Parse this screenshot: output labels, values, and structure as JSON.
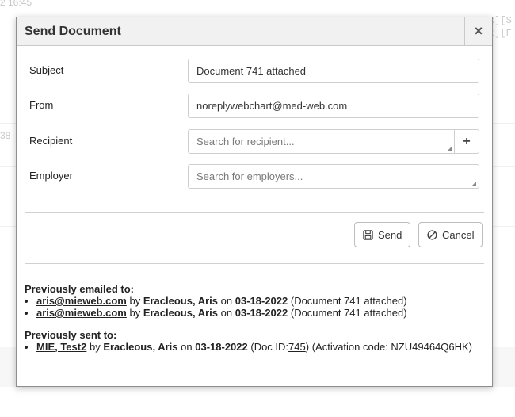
{
  "background": {
    "time_fragment": "2 16:45",
    "number_fragment": "38",
    "links_fragment_top": "x][S",
    "links_fragment_bottom": "t][F"
  },
  "dialog": {
    "title": "Send Document",
    "close_symbol": "×",
    "fields": {
      "subject": {
        "label": "Subject",
        "value": "Document 741 attached"
      },
      "from": {
        "label": "From",
        "value": "noreplywebchart@med-web.com"
      },
      "recipient": {
        "label": "Recipient",
        "placeholder": "Search for recipient...",
        "add_symbol": "+"
      },
      "employer": {
        "label": "Employer",
        "placeholder": "Search for employers..."
      }
    },
    "buttons": {
      "send": "Send",
      "cancel": "Cancel"
    },
    "previously_emailed": {
      "title": "Previously emailed to:",
      "entries": [
        {
          "email": "aris@mieweb.com",
          "by_text": "by",
          "sender": "Eracleous, Aris",
          "on_text": "on",
          "date": "03-18-2022",
          "note": "(Document 741 attached)"
        },
        {
          "email": "aris@mieweb.com",
          "by_text": "by",
          "sender": "Eracleous, Aris",
          "on_text": "on",
          "date": "03-18-2022",
          "note": "(Document 741 attached)"
        }
      ]
    },
    "previously_sent": {
      "title": "Previously sent to:",
      "entries": [
        {
          "recipient": "MIE, Test2",
          "by_text": "by",
          "sender": "Eracleous, Aris",
          "on_text": "on",
          "date": "03-18-2022",
          "doc_prefix": "(Doc ID:",
          "doc_id": "745",
          "doc_suffix": ")",
          "activation": "(Activation code: NZU49464Q6HK)"
        }
      ]
    }
  }
}
